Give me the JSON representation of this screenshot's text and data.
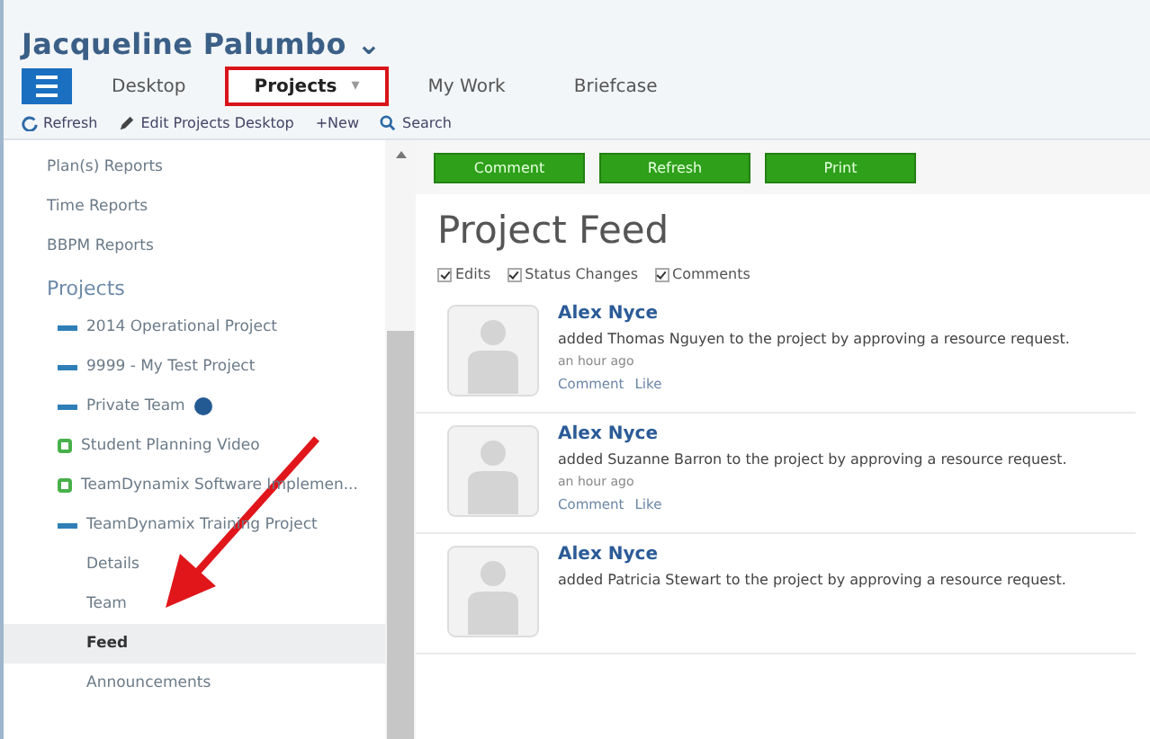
{
  "user": {
    "name": "Jacqueline Palumbo",
    "caret": "⌄"
  },
  "tabs": [
    {
      "label": "Desktop",
      "selected": false,
      "highlighted": false
    },
    {
      "label": "Projects",
      "selected": true,
      "highlighted": true,
      "caret": "▾"
    },
    {
      "label": "My Work",
      "selected": false,
      "highlighted": false
    },
    {
      "label": "Briefcase",
      "selected": false,
      "highlighted": false
    }
  ],
  "toolbar": [
    {
      "kind": "refresh",
      "label": "Refresh"
    },
    {
      "kind": "edit",
      "label": "Edit Projects Desktop"
    },
    {
      "kind": "new",
      "label": "+New"
    },
    {
      "kind": "search",
      "label": "Search"
    }
  ],
  "sidebar": {
    "reports": [
      "Plan(s) Reports",
      "Time Reports",
      "BBPM Reports"
    ],
    "heading": "Projects",
    "projects": [
      {
        "label": "2014 Operational Project",
        "kind": "dash"
      },
      {
        "label": "9999 - My Test Project",
        "kind": "dash"
      },
      {
        "label": "Private Team",
        "kind": "dash",
        "info": true
      },
      {
        "label": "Student Planning Video",
        "kind": "square"
      },
      {
        "label": "TeamDynamix Software Implemen...",
        "kind": "square"
      },
      {
        "label": "TeamDynamix Training Project",
        "kind": "dash",
        "children": [
          {
            "label": "Details",
            "selected": false
          },
          {
            "label": "Team",
            "selected": false
          },
          {
            "label": "Feed",
            "selected": true
          },
          {
            "label": "Announcements",
            "selected": false
          }
        ]
      }
    ]
  },
  "actions": [
    "Comment",
    "Refresh",
    "Print"
  ],
  "feed": {
    "title": "Project Feed",
    "filters": [
      {
        "label": "Edits",
        "checked": true
      },
      {
        "label": "Status Changes",
        "checked": true
      },
      {
        "label": "Comments",
        "checked": true
      }
    ],
    "entries": [
      {
        "author": "Alex Nyce",
        "text": "added Thomas Nguyen to the project by approving a resource request.",
        "time": "an hour ago",
        "links": [
          "Comment",
          "Like"
        ]
      },
      {
        "author": "Alex Nyce",
        "text": "added Suzanne Barron to the project by approving a resource request.",
        "time": "an hour ago",
        "links": [
          "Comment",
          "Like"
        ]
      },
      {
        "author": "Alex Nyce",
        "text": "added Patricia Stewart to the project by approving a resource request."
      }
    ]
  }
}
